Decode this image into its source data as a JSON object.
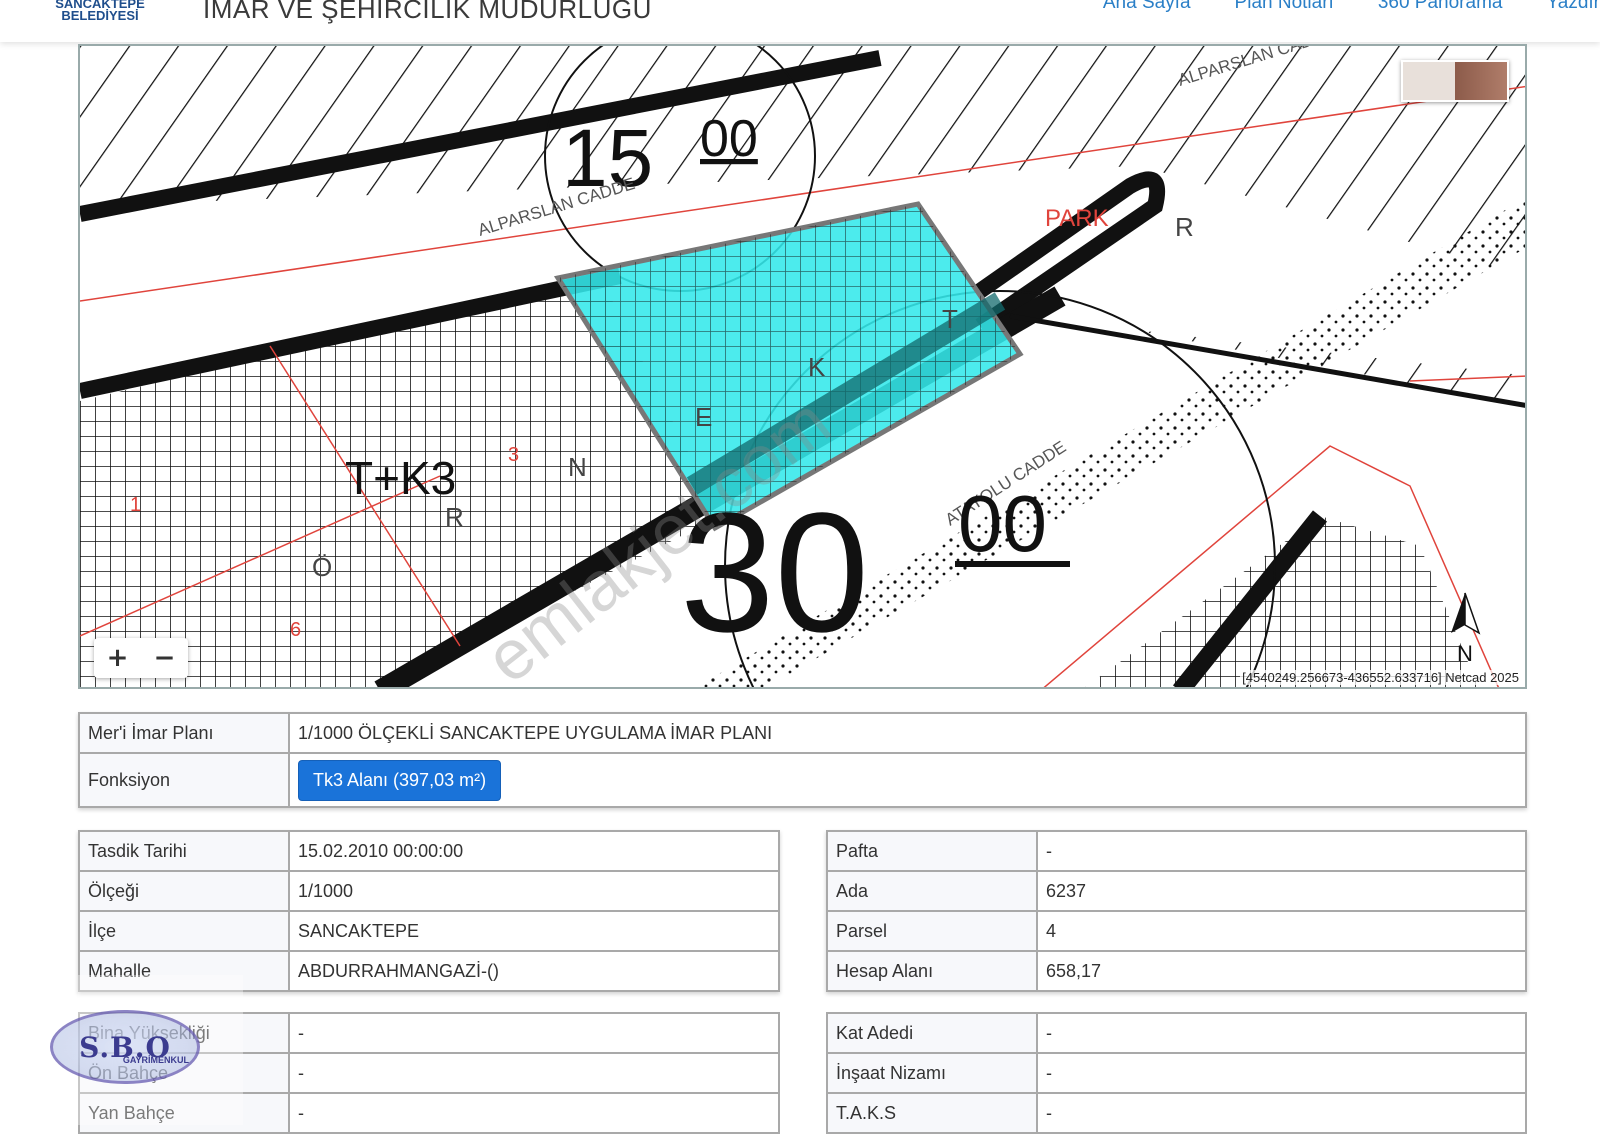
{
  "header": {
    "logo_line1": "SANCAKTEPE",
    "logo_line2": "BELEDİYESİ",
    "title": "İMAR VE ŞEHİRCİLİK MÜDÜRLÜĞÜ",
    "nav": [
      "Ana Sayfa",
      "Plan Notları",
      "360 Panorama",
      "Yazdır"
    ]
  },
  "map": {
    "labels": {
      "street_1": "ALPARSLAN CADDE",
      "street_2": "ALPARSLAN CADDE",
      "street_3": "ATAYOLU CADDE",
      "width_1_int": "15",
      "width_1_dec": "00",
      "width_2_int": "30",
      "width_2_dec": "00",
      "zone": "T+K3",
      "park": "PARK",
      "n_label": "N",
      "letters": [
        "R",
        "Ö",
        "R",
        "N",
        "E",
        "K",
        "T",
        "1",
        "3",
        "6"
      ]
    },
    "zoom_in": "+",
    "zoom_out": "−",
    "coords": "[4540249.256673-436552.633716] Netcad 2025",
    "north": "N",
    "watermark": "emlakjet.com",
    "colors": {
      "parcel_fill": "#33e8ea",
      "plan_red": "#e0443c",
      "road_black": "#111111"
    }
  },
  "plan": {
    "rows": [
      {
        "label": "Mer'i İmar Planı",
        "value": "1/1000 ÖLÇEKLİ SANCAKTEPE UYGULAMA İMAR PLANI"
      },
      {
        "label": "Fonksiyon",
        "value": "Tk3 Alanı (397,03 m²)"
      }
    ]
  },
  "left1": [
    {
      "label": "Tasdik Tarihi",
      "value": "15.02.2010 00:00:00"
    },
    {
      "label": "Ölçeği",
      "value": "1/1000"
    },
    {
      "label": "İlçe",
      "value": "SANCAKTEPE"
    },
    {
      "label": "Mahalle",
      "value": "ABDURRAHMANGAZİ-()"
    }
  ],
  "right1": [
    {
      "label": "Pafta",
      "value": "-"
    },
    {
      "label": "Ada",
      "value": "6237"
    },
    {
      "label": "Parsel",
      "value": "4"
    },
    {
      "label": "Hesap Alanı",
      "value": "658,17"
    }
  ],
  "left2": [
    {
      "label": "Bina Yüksekliği",
      "value": "-"
    },
    {
      "label": "Ön Bahçe",
      "value": "-"
    },
    {
      "label": "Yan Bahçe",
      "value": "-"
    }
  ],
  "right2": [
    {
      "label": "Kat Adedi",
      "value": "-"
    },
    {
      "label": "İnşaat Nizamı",
      "value": "-"
    },
    {
      "label": "T.A.K.S",
      "value": "-"
    }
  ],
  "overlay_logo": {
    "main": "S.B.O",
    "sub": "GAYRİMENKUL"
  }
}
